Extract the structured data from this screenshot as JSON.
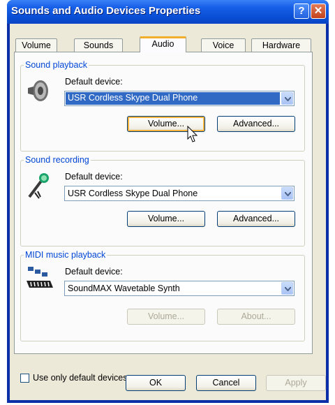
{
  "window": {
    "title": "Sounds and Audio Devices Properties",
    "help_glyph": "?",
    "close_glyph": "✕"
  },
  "tabs": [
    {
      "label": "Volume",
      "active": false
    },
    {
      "label": "Sounds",
      "active": false
    },
    {
      "label": "Audio",
      "active": true
    },
    {
      "label": "Voice",
      "active": false
    },
    {
      "label": "Hardware",
      "active": false
    }
  ],
  "playback": {
    "legend": "Sound playback",
    "default_label": "Default device:",
    "device": "USR Cordless Skype Dual Phone",
    "volume_btn": "Volume...",
    "advanced_btn": "Advanced..."
  },
  "recording": {
    "legend": "Sound recording",
    "default_label": "Default device:",
    "device": "USR Cordless Skype Dual Phone",
    "volume_btn": "Volume...",
    "advanced_btn": "Advanced..."
  },
  "midi": {
    "legend": "MIDI music playback",
    "default_label": "Default device:",
    "device": "SoundMAX Wavetable Synth",
    "volume_btn": "Volume...",
    "about_btn": "About..."
  },
  "options": {
    "use_default_label": "Use only default devices",
    "use_default_checked": false
  },
  "footer": {
    "ok": "OK",
    "cancel": "Cancel",
    "apply": "Apply"
  },
  "icons": [
    "speaker-icon",
    "microphone-icon",
    "midi-keyboard-icon",
    "dropdown-arrow-icon",
    "mouse-cursor-icon"
  ],
  "colors": {
    "titlebar": "#0a4fd6",
    "dialog_bg": "#ece9d8",
    "group_legend": "#0046d5",
    "selection": "#316ac5",
    "focus_ring": "#f8b33c"
  }
}
